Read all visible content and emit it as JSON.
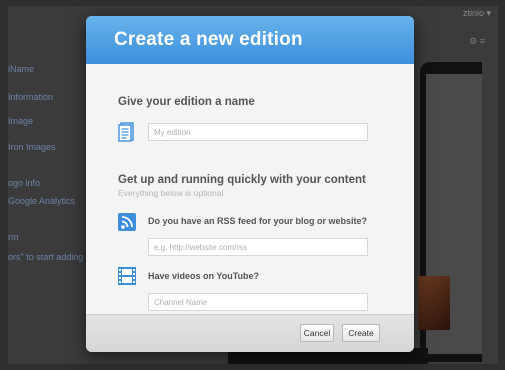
{
  "background": {
    "account_label": "ztinio ▾",
    "top_icons": "⚙ ≡",
    "sidebar_items": [
      "iName",
      "Information",
      "Image",
      "Iron Images",
      "ogo info",
      "Google Analytics",
      "rm",
      "ors\" to start adding"
    ]
  },
  "modal": {
    "title": "Create a new edition",
    "name_section": {
      "heading": "Give your edition a name",
      "icon": "document-icon",
      "input_placeholder": "My edition",
      "input_value": ""
    },
    "content_section": {
      "heading": "Get up and running quickly with your content",
      "subheading": "Everything below is optional",
      "rss": {
        "icon": "rss-icon",
        "question": "Do you have an RSS feed for your blog or website?",
        "input_placeholder": "e.g. http://website.com/rss",
        "input_value": ""
      },
      "youtube": {
        "icon": "film-icon",
        "question": "Have videos on YouTube?",
        "input_placeholder": "Channel Name",
        "input_value": ""
      }
    },
    "footer": {
      "cancel_label": "Cancel",
      "create_label": "Create"
    }
  },
  "colors": {
    "header_blue": "#4a9de3",
    "rss_blue": "#3d8edb",
    "overlay": "#2f2f2f"
  }
}
